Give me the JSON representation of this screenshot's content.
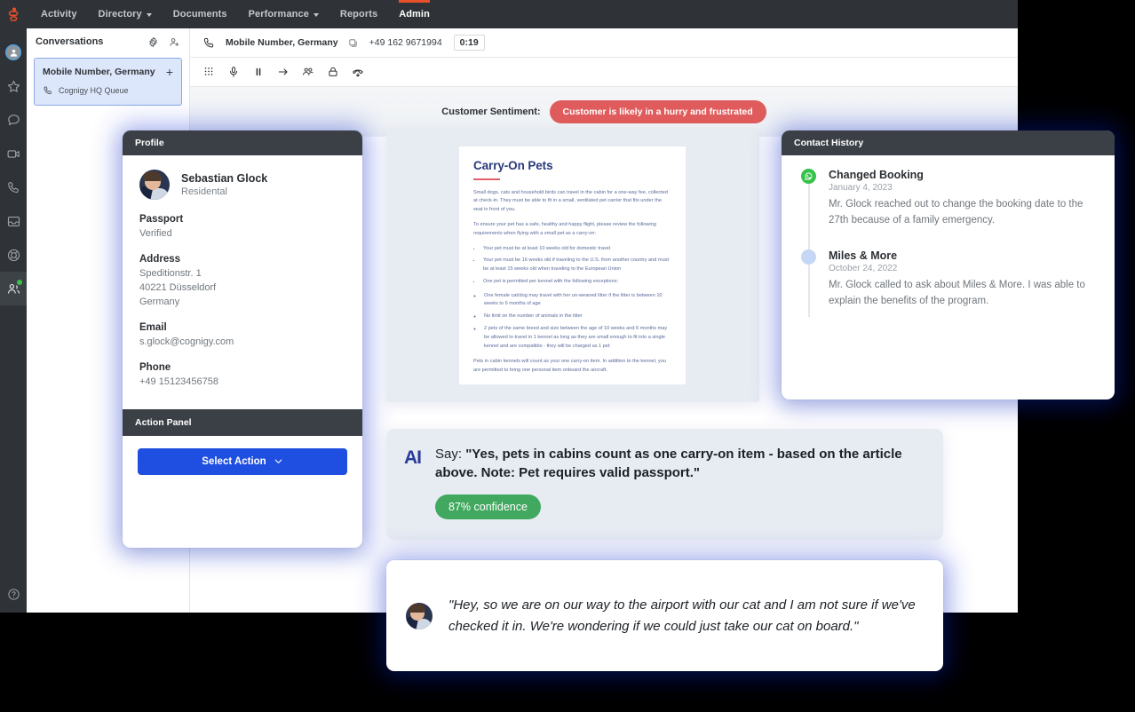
{
  "topnav": {
    "logo": "cognigy-logo",
    "items": [
      {
        "label": "Activity",
        "dropdown": false,
        "active": false
      },
      {
        "label": "Directory",
        "dropdown": true,
        "active": false
      },
      {
        "label": "Documents",
        "dropdown": false,
        "active": false
      },
      {
        "label": "Performance",
        "dropdown": true,
        "active": false
      },
      {
        "label": "Reports",
        "dropdown": false,
        "active": false
      },
      {
        "label": "Admin",
        "dropdown": false,
        "active": true
      }
    ],
    "active_indicator_color": "#e8502a"
  },
  "rail": {
    "items": [
      {
        "icon": "user-avatar-icon",
        "active": false
      },
      {
        "icon": "star-icon",
        "active": false
      },
      {
        "icon": "chat-bubble-icon",
        "active": false
      },
      {
        "icon": "video-camera-icon",
        "active": false
      },
      {
        "icon": "phone-icon",
        "active": false
      },
      {
        "icon": "inbox-icon",
        "active": false
      },
      {
        "icon": "support-headset-icon",
        "active": false
      },
      {
        "icon": "people-icon",
        "active": true,
        "badge": "online"
      }
    ],
    "help_icon": "question-circle-icon",
    "status_color": "#36c24a"
  },
  "conversations": {
    "title": "Conversations",
    "gear_icon": "gear-icon",
    "add_user_icon": "add-user-icon",
    "items": [
      {
        "title": "Mobile Number, Germany",
        "queue": "Cognigy HQ Queue",
        "queue_icon": "phone-icon",
        "plus": "+",
        "selected": true
      }
    ]
  },
  "call": {
    "phone_icon": "phone-icon",
    "name": "Mobile Number, Germany",
    "copy_icon": "copy-icon",
    "number": "+49 162 9671994",
    "timer": "0:19",
    "toolbar": [
      {
        "icon": "dialpad-icon"
      },
      {
        "icon": "microphone-icon"
      },
      {
        "icon": "pause-icon"
      },
      {
        "icon": "transfer-arrow-icon"
      },
      {
        "icon": "conference-people-icon"
      },
      {
        "icon": "secure-lock-icon"
      },
      {
        "icon": "hangup-icon"
      }
    ],
    "sentiment_label": "Customer Sentiment:",
    "sentiment_value": "Customer is likely in a hurry and frustrated",
    "sentiment_color": "#e05c5c"
  },
  "profile": {
    "panel_title": "Profile",
    "avatar": "user-photo",
    "name": "Sebastian Glock",
    "subtitle": "Residental",
    "fields": [
      {
        "label": "Passport",
        "value": "Verified"
      },
      {
        "label": "Address",
        "value": "Speditionstr. 1\n40221 Düsseldorf\nGermany"
      },
      {
        "label": "Email",
        "value": "s.glock@cognigy.com"
      },
      {
        "label": "Phone",
        "value": "+49 15123456758"
      }
    ],
    "action_panel_title": "Action Panel",
    "action_button": "Select Action",
    "action_button_color": "#1f4fe0",
    "chevron_icon": "chevron-down-icon"
  },
  "document": {
    "title": "Carry-On Pets",
    "paragraphs": [
      "Small dogs, cats and household birds can travel in the cabin for a one-way fee, collected at check-in. They must be able to fit in a small, ventilated pet carrier that fits under the seat in front of you.",
      "To ensure your pet has a safe, healthy and happy flight, please review the following requirements when flying with a small pet as a carry-on:"
    ],
    "bullets": [
      "Your pet must be at least 10 weeks old for domestic travel",
      "Your pet must be 16 weeks old if traveling to the U.S. from another country and must be at least 15 weeks old when traveling to the European Union",
      "One pet is permitted per kennel with the following exceptions:"
    ],
    "sub_bullets": [
      "One female cat/dog may travel with her un-weaned litter if the litter is between 10 weeks to 6 months of age",
      "No limit on the number of animals in the litter",
      "2 pets of the same breed and size between the age of 10 weeks and 6 months may be allowed to travel in 1 kennel as long as they are small enough to fit into a single kennel and are compatible - they will be charged as 1 pet"
    ],
    "footer": "Pets in cabin kennels will count as your one carry-on item. In addition to the kennel, you are permitted to bring one personal item onboard the aircraft."
  },
  "history": {
    "panel_title": "Contact History",
    "items": [
      {
        "icon": "whatsapp-icon",
        "icon_color": "#36c24a",
        "title": "Changed Booking",
        "date": "January 4, 2023",
        "text": "Mr. Glock reached out to change the booking date to the 27th because of a family emergency."
      },
      {
        "icon": "dot-icon",
        "icon_color": "#c5d7f5",
        "title": "Miles & More",
        "date": "October 24, 2022",
        "text": "Mr. Glock called to ask about Miles & More. I was able to explain the benefits of the program."
      }
    ]
  },
  "ai_suggestion": {
    "logo": "AI",
    "prefix": "Say:",
    "quote": "\"Yes, pets in cabins count as one carry-on item - based on the article above. Note: Pet requires valid passport.\"",
    "confidence": "87% confidence",
    "confidence_color": "#41a85f"
  },
  "customer_quote": {
    "avatar": "user-photo",
    "text": "\"Hey, so we are on our way to the airport with our cat and I am not sure if we've checked it in. We're wondering if we could just take our cat on board.\""
  }
}
